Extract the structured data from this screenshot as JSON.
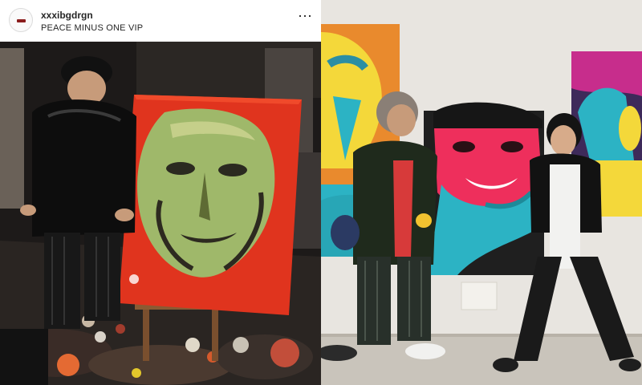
{
  "post": {
    "username": "xxxibgdrgn",
    "location": "PEACE MINUS ONE VIP",
    "more_icon": "more-horizontal-icon"
  },
  "photos": {
    "left": "painting-studio-photo",
    "right": "gallery-two-people-photo"
  },
  "colors": {
    "canvas_red": "#e0341e",
    "face_green": "#9fb86a",
    "pink_face": "#ee2f5c",
    "blue_hand": "#2cb3c4"
  }
}
